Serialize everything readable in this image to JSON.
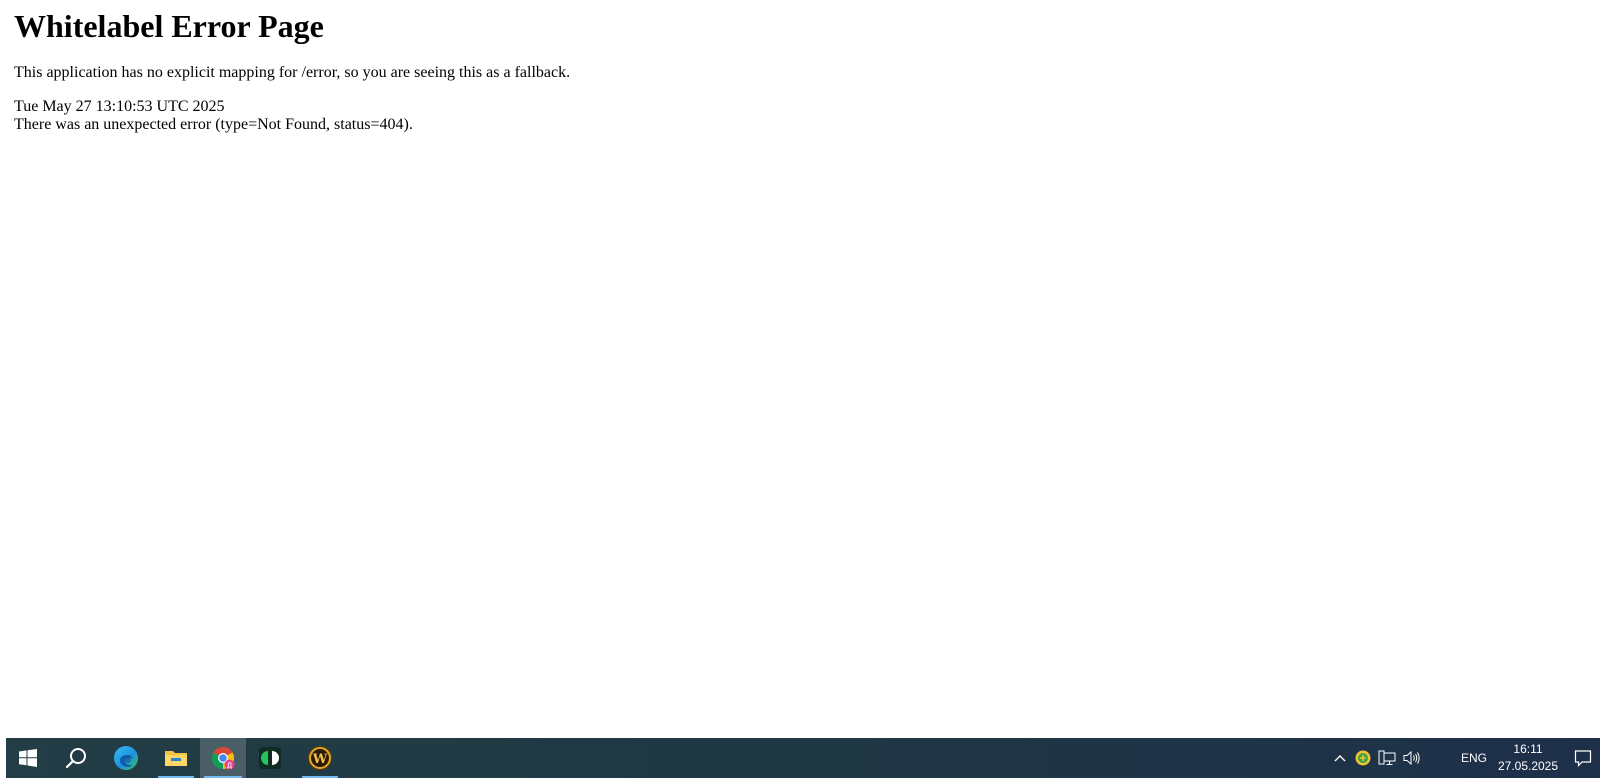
{
  "page": {
    "heading": "Whitelabel Error Page",
    "message": "This application has no explicit mapping for /error, so you are seeing this as a fallback.",
    "timestamp": "Tue May 27 13:10:53 UTC 2025",
    "error_text": "There was an unexpected error (type=Not Found, status=404)."
  },
  "taskbar": {
    "apps": [
      {
        "name": "start-icon",
        "running": false,
        "active": false
      },
      {
        "name": "search-icon",
        "running": false,
        "active": false
      },
      {
        "name": "edge-icon",
        "running": false,
        "active": false
      },
      {
        "name": "file-explorer-icon",
        "running": true,
        "active": false
      },
      {
        "name": "chrome-icon",
        "running": true,
        "active": true
      },
      {
        "name": "app-icon",
        "running": false,
        "active": false
      },
      {
        "name": "world-of-warcraft-icon",
        "running": true,
        "active": false
      }
    ],
    "tray": {
      "language": "ENG",
      "time": "16:11",
      "date": "27.05.2025"
    },
    "colors": {
      "background": "#223d45",
      "running_indicator": "#76b9ed"
    }
  }
}
